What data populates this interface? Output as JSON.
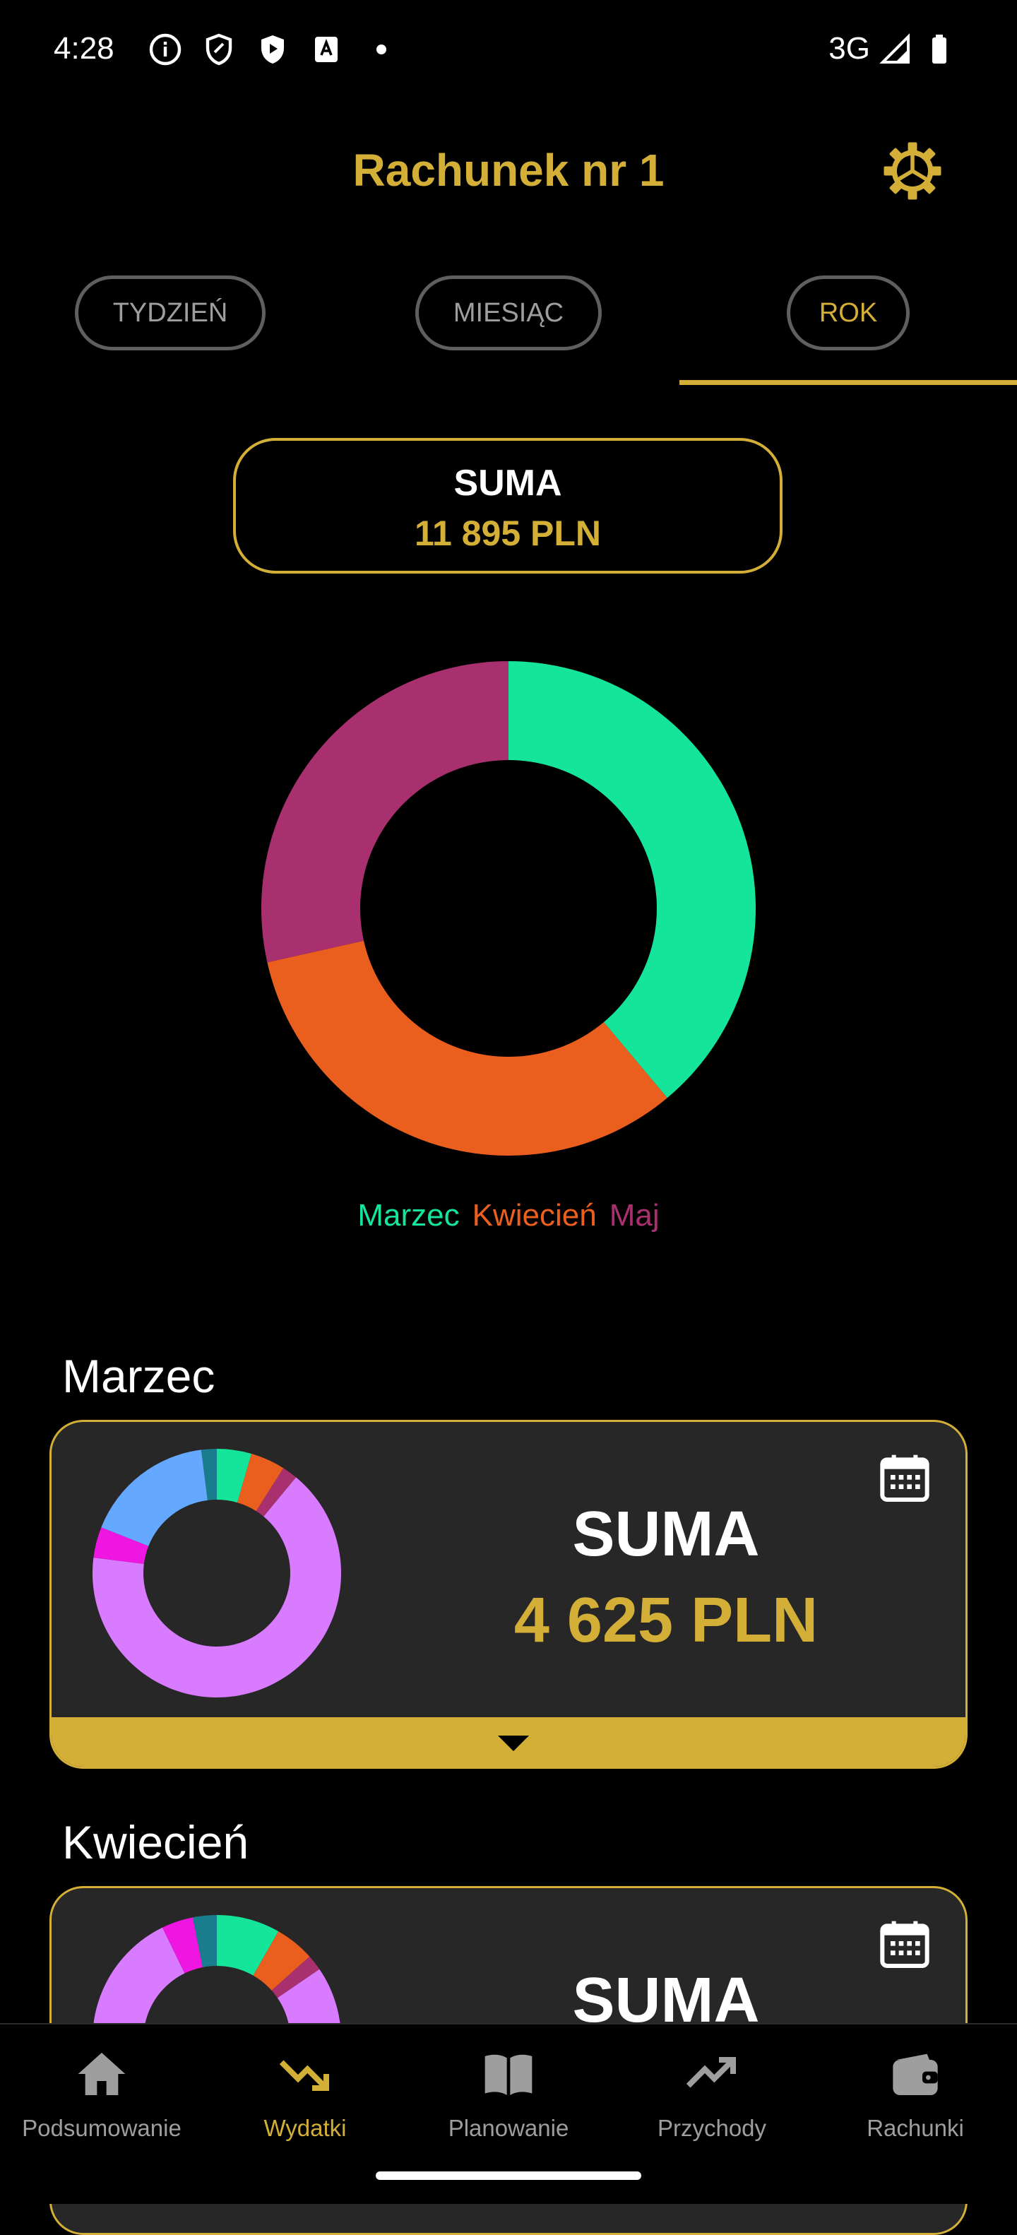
{
  "status_bar": {
    "time": "4:28",
    "network": "3G",
    "icons": [
      "info-icon",
      "shield-icon",
      "play-shield-icon",
      "font-icon",
      "dot-icon",
      "signal-icon",
      "battery-icon"
    ]
  },
  "header": {
    "title": "Rachunek nr 1",
    "settings_icon": "gear-icon"
  },
  "tabs": {
    "items": [
      {
        "label": "TYDZIEŃ",
        "active": false
      },
      {
        "label": "MIESIĄC",
        "active": false
      },
      {
        "label": "ROK",
        "active": true
      }
    ]
  },
  "summary": {
    "label": "SUMA",
    "value": "11 895 PLN"
  },
  "chart_data": {
    "type": "pie",
    "donut": true,
    "categories": [
      "Marzec",
      "Kwiecień",
      "Maj"
    ],
    "values": [
      38.9,
      32.6,
      28.5
    ],
    "colors": [
      "#15e59b",
      "#ea5f1e",
      "#a9306e"
    ],
    "legend": "bottom"
  },
  "months": [
    {
      "title": "Marzec",
      "sum_label": "SUMA",
      "sum_value": "4 625 PLN",
      "calendar_icon": "calendar-icon",
      "expand_icon": "chevron-down-icon",
      "segments": [
        {
          "value": 4.5,
          "color": "#15e59b"
        },
        {
          "value": 4.5,
          "color": "#ea5f1e"
        },
        {
          "value": 2,
          "color": "#a9306e"
        },
        {
          "value": 66,
          "color": "#d97bff"
        },
        {
          "value": 4,
          "color": "#ee16e0"
        },
        {
          "value": 17,
          "color": "#64a8ff"
        },
        {
          "value": 2,
          "color": "#1a7d8e"
        }
      ]
    },
    {
      "title": "Kwiecień",
      "sum_label": "SUMA",
      "calendar_icon": "calendar-icon",
      "segments": [
        {
          "value": 8,
          "color": "#15e59b"
        },
        {
          "value": 5,
          "color": "#ea5f1e"
        },
        {
          "value": 2,
          "color": "#a9306e"
        },
        {
          "value": 75,
          "color": "#d97bff"
        },
        {
          "value": 4,
          "color": "#ee16e0"
        },
        {
          "value": 3,
          "color": "#1a7d8e"
        }
      ]
    }
  ],
  "bottom_nav": {
    "items": [
      {
        "label": "Podsumowanie",
        "icon": "home-icon",
        "active": false
      },
      {
        "label": "Wydatki",
        "icon": "trending-down-icon",
        "active": true
      },
      {
        "label": "Planowanie",
        "icon": "book-icon",
        "active": false
      },
      {
        "label": "Przychody",
        "icon": "trending-up-icon",
        "active": false
      },
      {
        "label": "Rachunki",
        "icon": "wallet-icon",
        "active": false
      }
    ]
  }
}
